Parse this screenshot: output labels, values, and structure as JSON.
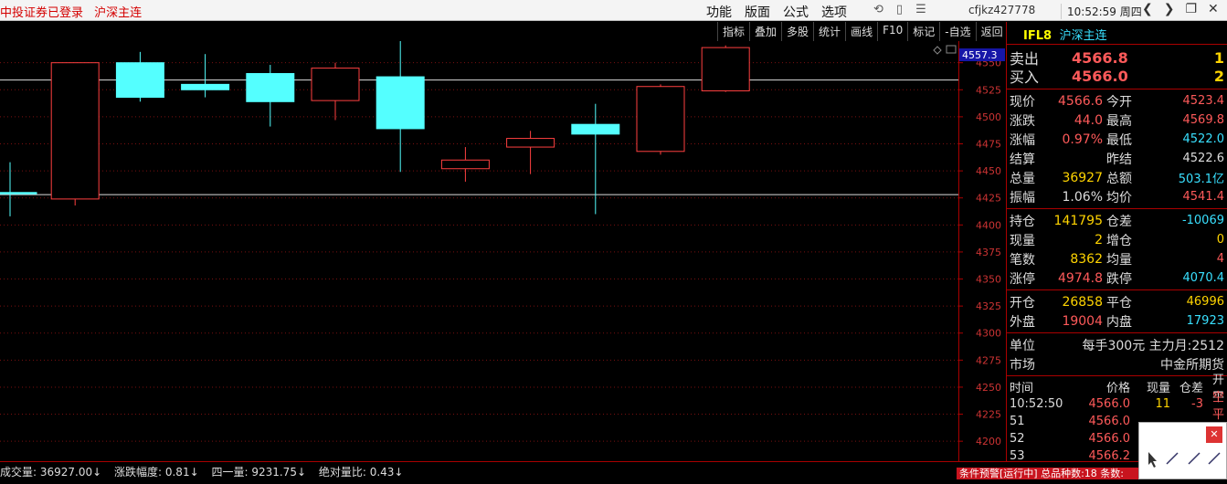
{
  "topbar": {
    "login_status": "中投证券已登录",
    "instrument": "沪深主连",
    "menu": [
      "功能",
      "版面",
      "公式",
      "选项"
    ],
    "icons": [
      "refresh-icon",
      "phone-icon",
      "list-icon"
    ],
    "user": "cfjkz427778",
    "time": "10:52:59 周四",
    "window_icons": [
      "back-arrow-icon",
      "forward-arrow-icon",
      "restore-icon",
      "close-icon"
    ]
  },
  "toolbar": [
    "指标",
    "叠加",
    "多股",
    "统计",
    "画线",
    "F10",
    "标记",
    "-自选",
    "返回"
  ],
  "chart_data": {
    "type": "candlestick",
    "y_ticks": [
      4550,
      4525,
      4500,
      4475,
      4450,
      4425,
      4400,
      4375,
      4350,
      4325,
      4300,
      4275,
      4250,
      4225,
      4200
    ],
    "ylim": [
      4190,
      4570
    ],
    "current_price_label": "4557.3",
    "high_annotation": "4577.4",
    "candles": [
      {
        "o": 4430,
        "c": 4430,
        "h": 4458,
        "l": 4408
      },
      {
        "o": 4424,
        "c": 4550,
        "h": 4550,
        "l": 4418
      },
      {
        "o": 4550,
        "c": 4518,
        "h": 4560,
        "l": 4514
      },
      {
        "o": 4530,
        "c": 4525,
        "h": 4558,
        "l": 4518
      },
      {
        "o": 4540,
        "c": 4514,
        "h": 4548,
        "l": 4491
      },
      {
        "o": 4515,
        "c": 4545,
        "h": 4550,
        "l": 4497
      },
      {
        "o": 4537,
        "c": 4489,
        "h": 4577.4,
        "l": 4449
      },
      {
        "o": 4452,
        "c": 4460,
        "h": 4472,
        "l": 4440
      },
      {
        "o": 4472,
        "c": 4480,
        "h": 4487,
        "l": 4447
      },
      {
        "o": 4493,
        "c": 4484,
        "h": 4512,
        "l": 4410
      },
      {
        "o": 4468,
        "c": 4528,
        "h": 4530,
        "l": 4465
      },
      {
        "o": 4524,
        "c": 4564,
        "h": 4566,
        "l": 4523
      }
    ],
    "hlines": [
      4534,
      4428
    ]
  },
  "panel": {
    "code": "IFL8",
    "name": "沪深主连",
    "sell_label": "卖出",
    "sell_price": "4566.8",
    "sell_vol": "1",
    "buy_label": "买入",
    "buy_price": "4566.0",
    "buy_vol": "2",
    "quote1": [
      {
        "l1": "现价",
        "v1": "4566.6",
        "c1": "red",
        "l2": "今开",
        "v2": "4523.4",
        "c2": "red"
      },
      {
        "l1": "涨跌",
        "v1": "44.0",
        "c1": "red",
        "l2": "最高",
        "v2": "4569.8",
        "c2": "red"
      },
      {
        "l1": "涨幅",
        "v1": "0.97%",
        "c1": "red",
        "l2": "最低",
        "v2": "4522.0",
        "c2": "cyan"
      },
      {
        "l1": "结算",
        "v1": "",
        "c1": "wht",
        "l2": "昨结",
        "v2": "4522.6",
        "c2": "wht"
      },
      {
        "l1": "总量",
        "v1": "36927",
        "c1": "yel",
        "l2": "总额",
        "v2": "503.1亿",
        "c2": "cyan"
      },
      {
        "l1": "振幅",
        "v1": "1.06%",
        "c1": "wht",
        "l2": "均价",
        "v2": "4541.4",
        "c2": "red"
      }
    ],
    "quote2": [
      {
        "l1": "持仓",
        "v1": "141795",
        "c1": "yel",
        "l2": "仓差",
        "v2": "-10069",
        "c2": "cyan"
      },
      {
        "l1": "现量",
        "v1": "2",
        "c1": "yel",
        "l2": "增仓",
        "v2": "0",
        "c2": "yel"
      },
      {
        "l1": "笔数",
        "v1": "8362",
        "c1": "yel",
        "l2": "均量",
        "v2": "4",
        "c2": "red"
      },
      {
        "l1": "涨停",
        "v1": "4974.8",
        "c1": "red",
        "l2": "跌停",
        "v2": "4070.4",
        "c2": "cyan"
      }
    ],
    "quote3": [
      {
        "l1": "开仓",
        "v1": "26858",
        "c1": "yel",
        "l2": "平仓",
        "v2": "46996",
        "c2": "yel"
      },
      {
        "l1": "外盘",
        "v1": "19004",
        "c1": "red",
        "l2": "内盘",
        "v2": "17923",
        "c2": "cyan"
      }
    ],
    "unit_label": "单位",
    "unit_value": "每手300元  主力月:2512",
    "market_label": "市场",
    "market_value": "中金所期货",
    "tick_headers": [
      "时间",
      "价格",
      "现量",
      "仓差",
      "开平"
    ],
    "ticks": [
      {
        "t": "10:52:50",
        "p": "4566.0",
        "v": "11",
        "d": "-3",
        "k": "空平"
      },
      {
        "t": "51",
        "p": "4566.0",
        "v": "",
        "d": "",
        "k": ""
      },
      {
        "t": "52",
        "p": "4566.0",
        "v": "",
        "d": "",
        "k": ""
      },
      {
        "t": "53",
        "p": "4566.2",
        "v": "",
        "d": "",
        "k": ""
      }
    ]
  },
  "status": {
    "volume": "成交量: 36927.00↓",
    "amplitude": "涨跌幅度: 0.81↓",
    "four_one": "四一量: 9231.75↓",
    "ratio": "绝对量比: 0.43↓",
    "warning": "条件预警[运行中] 总品种数:18 条数:"
  }
}
